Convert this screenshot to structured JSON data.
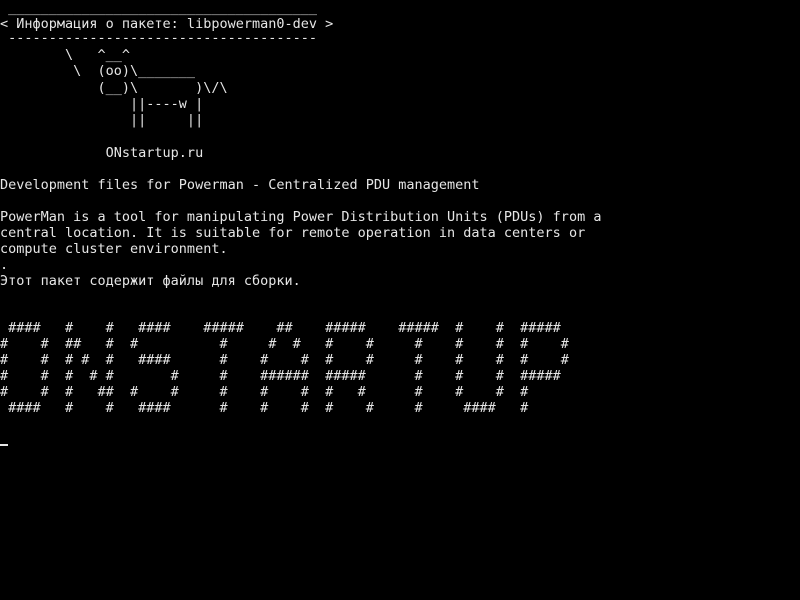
{
  "terminal": {
    "cowsay": {
      "border_top": " ______________________________________",
      "title": "< Информация о пакете: libpowerman0-dev >",
      "border_bottom": " --------------------------------------",
      "cow": [
        "        \\   ^__^",
        "         \\  (oo)\\_______",
        "            (__)\\       )\\/\\",
        "                ||----w |",
        "                ||     ||"
      ]
    },
    "site": "             ONstartup.ru",
    "summary": "Development files for Powerman - Centralized PDU management",
    "description": [
      "PowerMan is a tool for manipulating Power Distribution Units (PDUs) from a",
      "central location. It is suitable for remote operation in data centers or",
      "compute cluster environment.",
      ".",
      "Этот пакет содержит файлы для сборки."
    ],
    "banner": [
      " ####   #    #   ####    #####    ##    #####    #####  #    #  #####",
      "#    #  ##   #  #          #     #  #   #    #     #    #    #  #    #",
      "#    #  # #  #   ####      #    #    #  #    #     #    #    #  #    #",
      "#    #  #  # #       #     #    ######  #####      #    #    #  #####",
      "#    #  #   ##  #    #     #    #    #  #   #      #    #    #  #",
      " ####   #    #   ####      #    #    #  #    #     #     ####   #"
    ]
  }
}
